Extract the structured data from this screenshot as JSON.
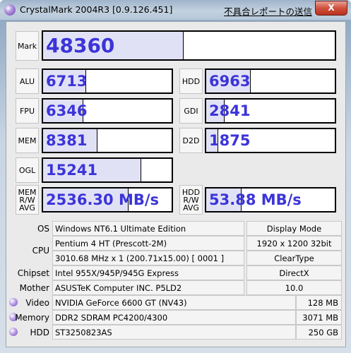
{
  "window": {
    "title": "CrystalMark 2004R3 [0.9.126.451]",
    "report_link": "不具合レポートの送信",
    "close_label": "X"
  },
  "scores": {
    "mark": {
      "label": "Mark",
      "value": "48360",
      "fill": 0.48
    },
    "alu": {
      "label": "ALU",
      "value": "6713",
      "fill": 0.33
    },
    "hdd": {
      "label": "HDD",
      "value": "6963",
      "fill": 0.34
    },
    "fpu": {
      "label": "FPU",
      "value": "6346",
      "fill": 0.31
    },
    "gdi": {
      "label": "GDI",
      "value": "2841",
      "fill": 0.14
    },
    "mem": {
      "label": "MEM",
      "value": "8381",
      "fill": 0.42
    },
    "d2d": {
      "label": "D2D",
      "value": "1875",
      "fill": 0.09
    },
    "ogl": {
      "label": "OGL",
      "value": "15241",
      "fill": 0.76
    },
    "mem_rw": {
      "label_lines": [
        "MEM",
        "R/W",
        "AVG"
      ],
      "value": "2536.30 MB/s",
      "fill": 0.66
    },
    "hdd_rw": {
      "label_lines": [
        "HDD",
        "R/W",
        "AVG"
      ],
      "value": "53.88 MB/s",
      "fill": 0.27
    }
  },
  "info": {
    "os": {
      "label": "OS",
      "value": "Windows NT6.1 Ultimate Edition"
    },
    "display_mode": {
      "label": "Display Mode",
      "value": "1920 x 1200 32bit"
    },
    "cpu": {
      "label": "CPU",
      "line1": "Pentium 4 HT (Prescott-2M)",
      "line2": "3010.68 MHz x 1 (200.71x15.00) [ 0001 ]"
    },
    "cleartype": {
      "label": "ClearType"
    },
    "chipset": {
      "label": "Chipset",
      "value": "Intel 955X/945P/945G Express"
    },
    "directx": {
      "label": "DirectX",
      "value": "10.0"
    },
    "mother": {
      "label": "Mother",
      "value": "ASUSTeK Computer INC. P5LD2"
    },
    "video": {
      "label": "Video",
      "value": "NVIDIA GeForce 6600 GT (NV43)",
      "size": "128 MB"
    },
    "memory": {
      "label": "Memory",
      "value": "DDR2 SDRAM PC4200/4300",
      "size": "3071 MB"
    },
    "hdd": {
      "label": "HDD",
      "value": "ST3250823AS",
      "size": "250 GB"
    }
  }
}
